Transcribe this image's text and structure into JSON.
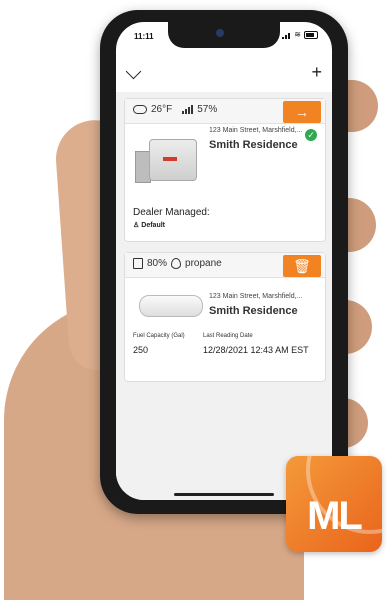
{
  "status": {
    "time": "11:11"
  },
  "generator_card": {
    "weather": "26°F",
    "signal_pct": "57%",
    "address": "123 Main Street, Marshfield,...",
    "name": "Smith Residence",
    "dealer_label": "Dealer Managed:",
    "dealer_value": "Default",
    "action_icon": "arrow-right-icon",
    "status_icon": "checkmark-icon"
  },
  "fuel_card": {
    "fuel_pct": "80%",
    "fuel_type": "propane",
    "address": "123 Main Street, Marshfield,...",
    "name": "Smith Residence",
    "capacity_label": "Fuel Capacity (Gal)",
    "capacity_value": "250",
    "reading_label": "Last Reading Date",
    "reading_value": "12/28/2021 12:43 AM EST",
    "action_icon": "trash-icon"
  },
  "colors": {
    "accent": "#f28322",
    "success": "#2fa84f"
  },
  "logo": {
    "text": "ML"
  }
}
